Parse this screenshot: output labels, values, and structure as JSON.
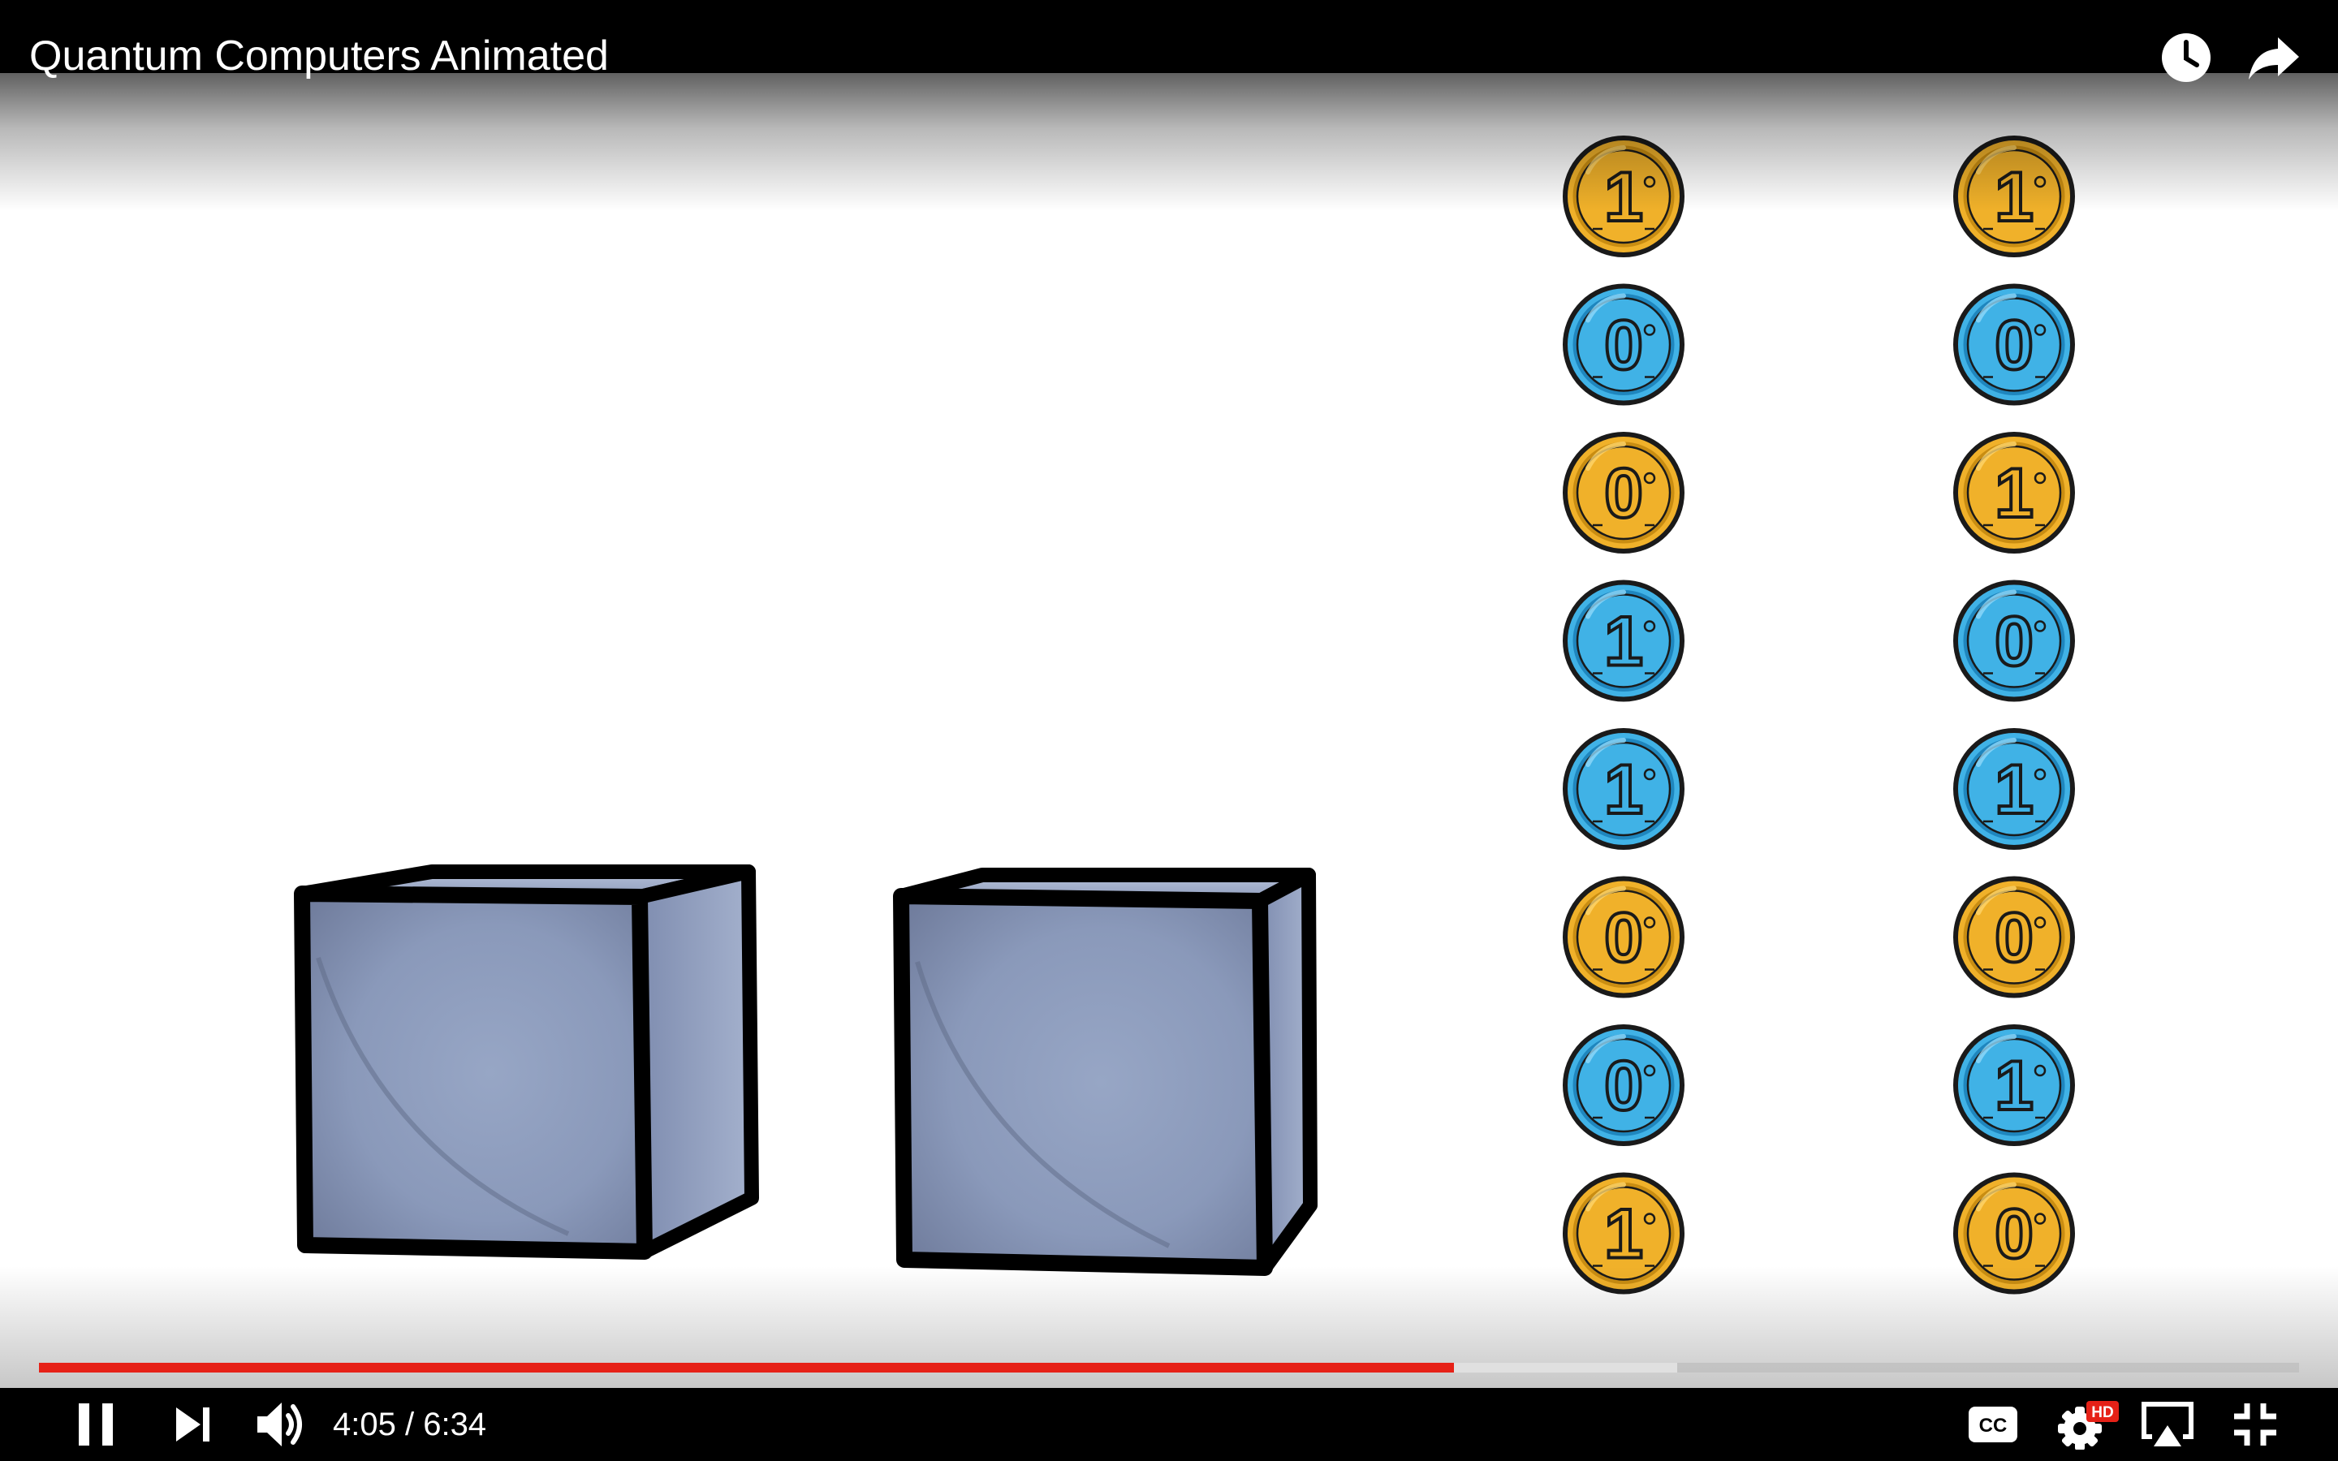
{
  "player": {
    "title": "Quantum Computers Animated",
    "controls": {
      "current_time": "4:05",
      "separator": " / ",
      "duration": "6:34",
      "played_fraction": 0.626,
      "buffered_fraction": 0.725,
      "accent_color": "#e62117",
      "hd_badge": "HD",
      "icons": [
        "pause-icon",
        "next-icon",
        "volume-icon",
        "captions-icon",
        "settings-icon",
        "airplay-icon",
        "exit-fullscreen-icon",
        "watch-later-icon",
        "share-icon"
      ]
    }
  },
  "scene": {
    "boxes": 2,
    "coin_colors": {
      "gold": "#f0b12a",
      "blue": "#40b2e6"
    },
    "coin_columns": [
      [
        {
          "digit": "1",
          "color": "gold"
        },
        {
          "digit": "0",
          "color": "blue"
        },
        {
          "digit": "0",
          "color": "gold"
        },
        {
          "digit": "1",
          "color": "blue"
        },
        {
          "digit": "1",
          "color": "blue"
        },
        {
          "digit": "0",
          "color": "gold"
        },
        {
          "digit": "0",
          "color": "blue"
        },
        {
          "digit": "1",
          "color": "gold"
        }
      ],
      [
        {
          "digit": "1",
          "color": "gold"
        },
        {
          "digit": "0",
          "color": "blue"
        },
        {
          "digit": "1",
          "color": "gold"
        },
        {
          "digit": "0",
          "color": "blue"
        },
        {
          "digit": "1",
          "color": "blue"
        },
        {
          "digit": "0",
          "color": "gold"
        },
        {
          "digit": "1",
          "color": "blue"
        },
        {
          "digit": "0",
          "color": "gold"
        }
      ]
    ]
  }
}
